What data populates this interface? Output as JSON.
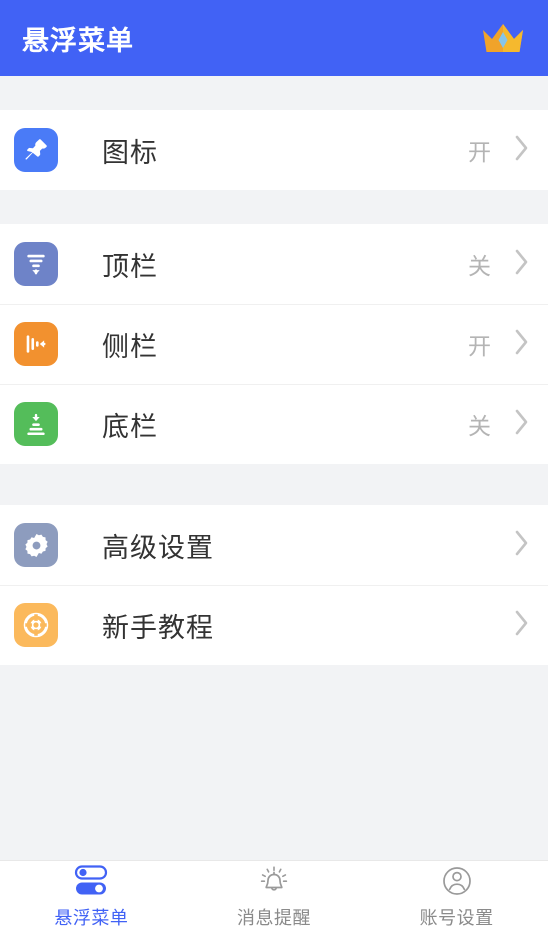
{
  "header": {
    "title": "悬浮菜单",
    "crown_icon": "crown-icon",
    "bg_color": "#4162f5",
    "title_color": "#ffffff"
  },
  "sections": [
    {
      "name": "icon-section",
      "rows": [
        {
          "id": "icon",
          "label": "图标",
          "status": "开",
          "icon": "pushpin-icon",
          "icon_bg": "#4a7bf7"
        }
      ]
    },
    {
      "name": "bars-section",
      "rows": [
        {
          "id": "top-bar",
          "label": "顶栏",
          "status": "关",
          "icon": "top-bar-icon",
          "icon_bg": "#6e83c8"
        },
        {
          "id": "side-bar",
          "label": "侧栏",
          "status": "开",
          "icon": "side-bar-icon",
          "icon_bg": "#f2912f"
        },
        {
          "id": "bottom-bar",
          "label": "底栏",
          "status": "关",
          "icon": "bottom-bar-icon",
          "icon_bg": "#54bd5a"
        }
      ]
    },
    {
      "name": "settings-section",
      "rows": [
        {
          "id": "advanced-settings",
          "label": "高级设置",
          "status": "",
          "icon": "gear-icon",
          "icon_bg": "#8d9cbe"
        },
        {
          "id": "beginner-tutorial",
          "label": "新手教程",
          "status": "",
          "icon": "lifebuoy-icon",
          "icon_bg": "#fbb košik"
        }
      ]
    }
  ],
  "tabbar": {
    "tabs": [
      {
        "id": "floating-menu",
        "label": "悬浮菜单",
        "icon": "toggles-icon",
        "active": true
      },
      {
        "id": "notifications",
        "label": "消息提醒",
        "icon": "bell-icon",
        "active": false
      },
      {
        "id": "account-settings",
        "label": "账号设置",
        "icon": "user-circle-icon",
        "active": false
      }
    ],
    "active_color": "#4162f5",
    "inactive_color": "#8a8a8a"
  },
  "colors": {
    "page_bg": "#f2f3f5",
    "card_bg": "#ffffff",
    "primary": "#4162f5",
    "label": "#333333",
    "status": "#b4b4b4",
    "chevron": "#c4c4c4"
  }
}
